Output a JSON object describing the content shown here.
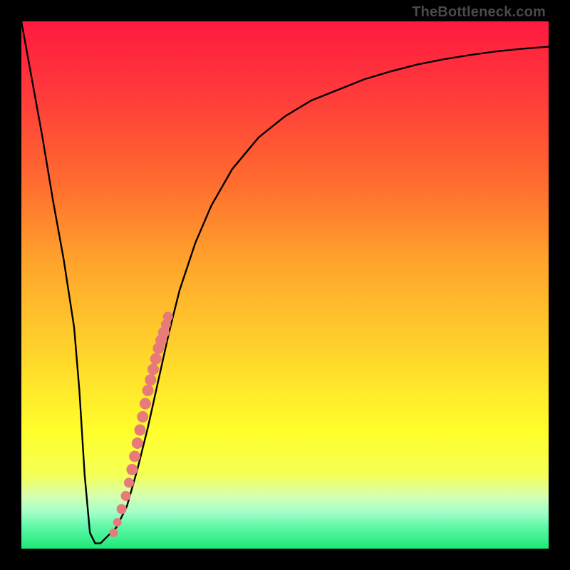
{
  "watermark": "TheBottleneck.com",
  "colors": {
    "frame": "#000000",
    "line": "#000000",
    "dots": "#e77b79",
    "gradient_stops": [
      {
        "pct": 0,
        "color": "#ff1a40"
      },
      {
        "pct": 14,
        "color": "#ff3b3b"
      },
      {
        "pct": 30,
        "color": "#ff6a2f"
      },
      {
        "pct": 46,
        "color": "#ffa52b"
      },
      {
        "pct": 62,
        "color": "#ffd22b"
      },
      {
        "pct": 78,
        "color": "#ffff2b"
      },
      {
        "pct": 86,
        "color": "#f4ff55"
      },
      {
        "pct": 90,
        "color": "#d6ffb0"
      },
      {
        "pct": 93,
        "color": "#a4ffc9"
      },
      {
        "pct": 96,
        "color": "#5cf7a6"
      },
      {
        "pct": 100,
        "color": "#1de877"
      }
    ]
  },
  "chart_data": {
    "type": "line",
    "title": "",
    "xlabel": "",
    "ylabel": "",
    "xlim": [
      0,
      100
    ],
    "ylim": [
      0,
      100
    ],
    "series": [
      {
        "name": "bottleneck-curve",
        "x": [
          0,
          2,
          4,
          6,
          8,
          10,
          11,
          12,
          13,
          14,
          15,
          16,
          18,
          20,
          22,
          24,
          26,
          28,
          30,
          33,
          36,
          40,
          45,
          50,
          55,
          60,
          65,
          70,
          75,
          80,
          85,
          90,
          95,
          100
        ],
        "y": [
          100,
          89,
          78,
          66,
          55,
          42,
          30,
          14,
          3,
          1,
          1,
          2,
          4,
          8,
          15,
          23,
          32,
          41,
          49,
          58,
          65,
          72,
          78,
          82,
          85,
          87,
          89,
          90.5,
          91.8,
          92.8,
          93.6,
          94.3,
          94.8,
          95.2
        ]
      }
    ],
    "scatter": {
      "name": "highlight-dots",
      "x": [
        17.5,
        18.2,
        19.0,
        19.8,
        20.4,
        21.0,
        21.5,
        22.0,
        22.5,
        23.0,
        23.5,
        24.0,
        24.5,
        25.0,
        25.5,
        26.0,
        26.5,
        27.0,
        27.4,
        27.8
      ],
      "y": [
        3.0,
        5.0,
        7.5,
        10.0,
        12.5,
        15.0,
        17.5,
        20.0,
        22.5,
        25.0,
        27.5,
        30.0,
        32.0,
        34.0,
        36.0,
        38.0,
        39.5,
        41.0,
        42.5,
        44.0
      ],
      "r": [
        6,
        6,
        7,
        7,
        7,
        8,
        8,
        8,
        8,
        8,
        8,
        8,
        8,
        8,
        8,
        8,
        8,
        8,
        7,
        7
      ]
    }
  }
}
